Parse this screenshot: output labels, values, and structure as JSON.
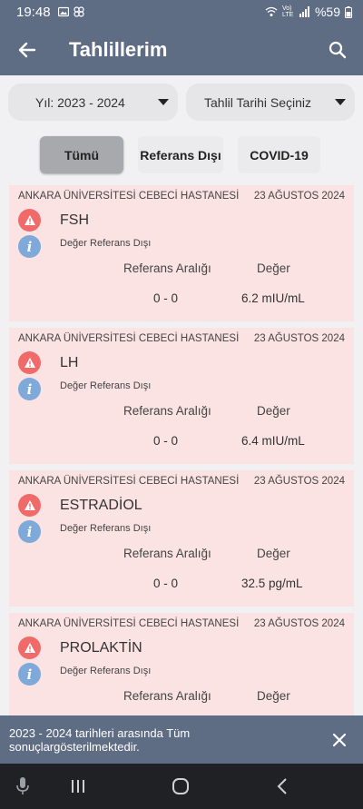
{
  "status_bar": {
    "time": "19:48",
    "battery": "%59",
    "network_label": "Vo) LTE",
    "left_icons": [
      "image-icon",
      "pinwheel-icon"
    ],
    "right_icons": [
      "wifi-icon",
      "signal-icon",
      "battery-icon"
    ]
  },
  "app_bar": {
    "title": "Tahlillerim",
    "back_icon": "arrow-left-icon",
    "search_icon": "search-icon"
  },
  "filters": {
    "year": "Yıl: 2023 - 2024",
    "date": "Tahlil Tarihi Seçiniz"
  },
  "tabs": [
    {
      "label": "Tümü",
      "active": true
    },
    {
      "label": "Referans Dışı",
      "active": false
    },
    {
      "label": "COVID-19",
      "active": false
    }
  ],
  "table_labels": {
    "ref_header": "Referans Aralığı",
    "value_header": "Değer"
  },
  "results": [
    {
      "hospital": "ANKARA ÜNİVERSİTESİ CEBECİ HASTANESİ",
      "date": "23 AĞUSTOS 2024",
      "test": "FSH",
      "status": "Değer Referans Dışı",
      "reference": "0 - 0",
      "value": "6.2 mIU/mL"
    },
    {
      "hospital": "ANKARA ÜNİVERSİTESİ CEBECİ HASTANESİ",
      "date": "23 AĞUSTOS 2024",
      "test": "LH",
      "status": "Değer Referans Dışı",
      "reference": "0 - 0",
      "value": "6.4 mIU/mL"
    },
    {
      "hospital": "ANKARA ÜNİVERSİTESİ CEBECİ HASTANESİ",
      "date": "23 AĞUSTOS 2024",
      "test": "ESTRADİOL",
      "status": "Değer Referans Dışı",
      "reference": "0 - 0",
      "value": "32.5 pg/mL"
    },
    {
      "hospital": "ANKARA ÜNİVERSİTESİ CEBECİ HASTANESİ",
      "date": "23 AĞUSTOS 2024",
      "test": "PROLAKTİN",
      "status": "Değer Referans Dışı",
      "reference": "",
      "value": ""
    }
  ],
  "snackbar": {
    "message": "2023 - 2024 tarihleri arasında Tüm sonuçlargösterilmektedir.",
    "close_icon": "close-icon"
  },
  "nav_bar": {
    "icons": [
      "microphone-icon",
      "recents-icon",
      "home-icon",
      "back-icon"
    ]
  },
  "colors": {
    "primary": "#5e6c84",
    "card_bg": "#fbe3e3",
    "warning": "#f06a6a",
    "info": "#7fa9d8"
  }
}
